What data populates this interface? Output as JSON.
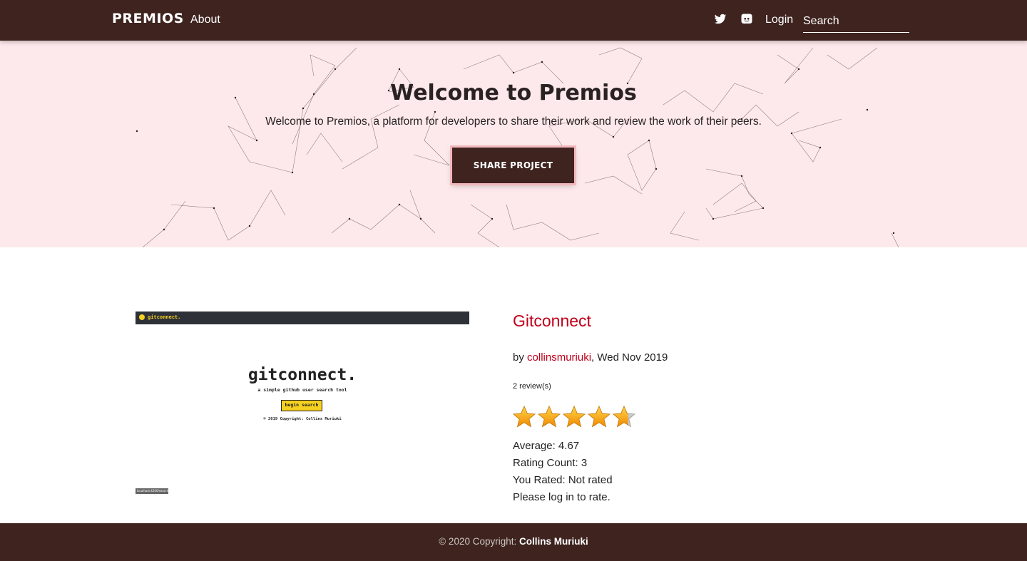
{
  "navbar": {
    "brand": "PREMIOS",
    "about_label": "About",
    "login_label": "Login",
    "search_placeholder": "Search",
    "icons": [
      "twitter-icon",
      "discord-icon"
    ]
  },
  "hero": {
    "title": "Welcome to Premios",
    "subtitle": "Welcome to Premios, a platform for developers to share their work and review the work of their peers.",
    "share_button": "SHARE PROJECT"
  },
  "project": {
    "screenshot": {
      "bar_text": "gitconnect.",
      "title": "gitconnect.",
      "tagline": "a simple github user search tool",
      "button": "begin search",
      "copyright": "© 2019 Copyright: Collins Muriuki",
      "url": "localhost:4200/search"
    },
    "title": "Gitconnect",
    "by_prefix": "by ",
    "author": "collinsmuriuki",
    "date": ", Wed Nov 2019",
    "reviews": "2 review(s)",
    "rating_stars": 4.67,
    "rating_max": 5,
    "average": "Average: 4.67",
    "rating_count": "Rating Count: 3",
    "you_rated": "You Rated: Not rated",
    "login_prompt": "Please log in to rate."
  },
  "footer": {
    "prefix": "© 2020 Copyright: ",
    "author": "Collins Muriuki"
  },
  "colors": {
    "nav_bg": "#3e231f",
    "hero_bg": "#fde9eb",
    "accent_red": "#c0001a",
    "star_gold": "#f5a623"
  }
}
